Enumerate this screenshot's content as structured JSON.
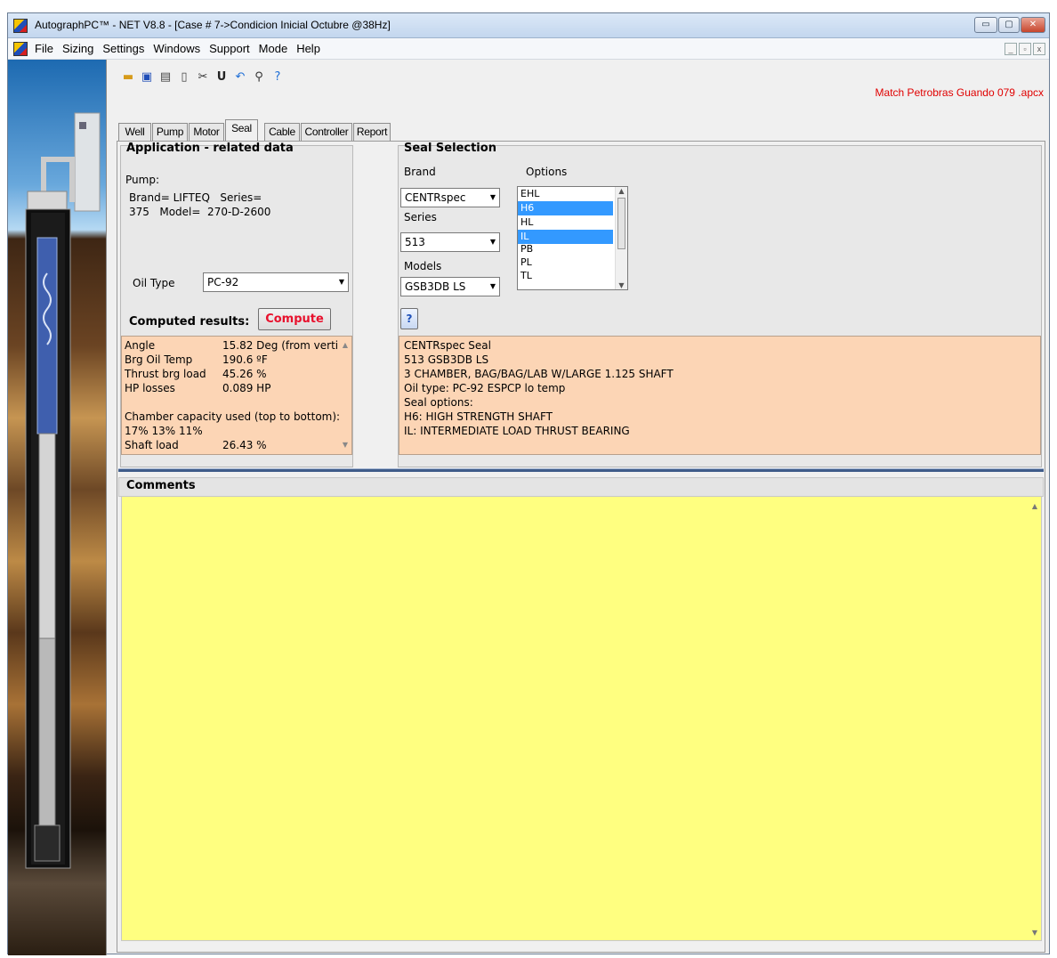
{
  "window": {
    "title": "AutographPC™ - NET V8.8 - [Case # 7->Condicion Inicial Octubre @38Hz]",
    "controls": {
      "minimize": "▭",
      "maximize": "▢",
      "close": "✕"
    }
  },
  "menu": {
    "items": [
      "File",
      "Sizing",
      "Settings",
      "Windows",
      "Support",
      "Mode",
      "Help"
    ],
    "mdi_controls": [
      "_",
      "▫",
      "x"
    ]
  },
  "toolbar": {
    "icons": [
      "open-folder-icon",
      "save-icon",
      "print-icon",
      "page-icon",
      "tools-icon",
      "units-icon",
      "undo-icon",
      "wrench-icon",
      "help-icon"
    ]
  },
  "file_name": "Match Petrobras Guando 079 .apcx",
  "tabs": [
    "Well",
    "Pump",
    "Motor",
    "Seal",
    "Cable",
    "Controller",
    "Report"
  ],
  "active_tab": "Seal",
  "application": {
    "header": "Application - related data",
    "pump_label": "Pump:",
    "pump_line1": "Brand= LIFTEQ   Series=",
    "pump_line2": "375   Model=  270-D-2600",
    "oil_type_label": "Oil Type",
    "oil_type_value": "PC-92"
  },
  "computed": {
    "label": "Computed results:",
    "button": "Compute",
    "rows": [
      {
        "k": "Angle",
        "v": "15.82 Deg (from verti"
      },
      {
        "k": "Brg Oil Temp",
        "v": "190.6 ºF"
      },
      {
        "k": "Thrust brg load",
        "v": "45.26 %"
      },
      {
        "k": "HP losses",
        "v": "0.089 HP"
      }
    ],
    "chamber_label": "Chamber capacity used (top to bottom):",
    "chamber_values": "17% 13% 11%",
    "shaft_label": "Shaft load",
    "shaft_value": "26.43 %"
  },
  "seal": {
    "header": "Seal Selection",
    "brand_label": "Brand",
    "brand_value": "CENTRspec",
    "series_label": "Series",
    "series_value": "513",
    "models_label": "Models",
    "models_value": "GSB3DB LS",
    "options_label": "Options",
    "options": [
      {
        "name": "EHL",
        "selected": false
      },
      {
        "name": "H6",
        "selected": true
      },
      {
        "name": "HL",
        "selected": false
      },
      {
        "name": "IL",
        "selected": true
      },
      {
        "name": "PB",
        "selected": false
      },
      {
        "name": "PL",
        "selected": false
      },
      {
        "name": "TL",
        "selected": false
      }
    ],
    "help_button": "?",
    "description": [
      "CENTRspec Seal",
      "513 GSB3DB LS",
      "3 CHAMBER, BAG/BAG/LAB W/LARGE 1.125 SHAFT",
      "Oil type: PC-92 ESPCP lo temp",
      "Seal options:",
      "H6: HIGH STRENGTH SHAFT",
      "IL: INTERMEDIATE LOAD THRUST BEARING"
    ]
  },
  "comments": {
    "label": "Comments",
    "text": ""
  },
  "colors": {
    "peach": "#fcd5b5",
    "comments_bg": "#ffff80",
    "selection": "#3399ff",
    "compute_text": "#e8112d",
    "file_name": "#e00000"
  }
}
